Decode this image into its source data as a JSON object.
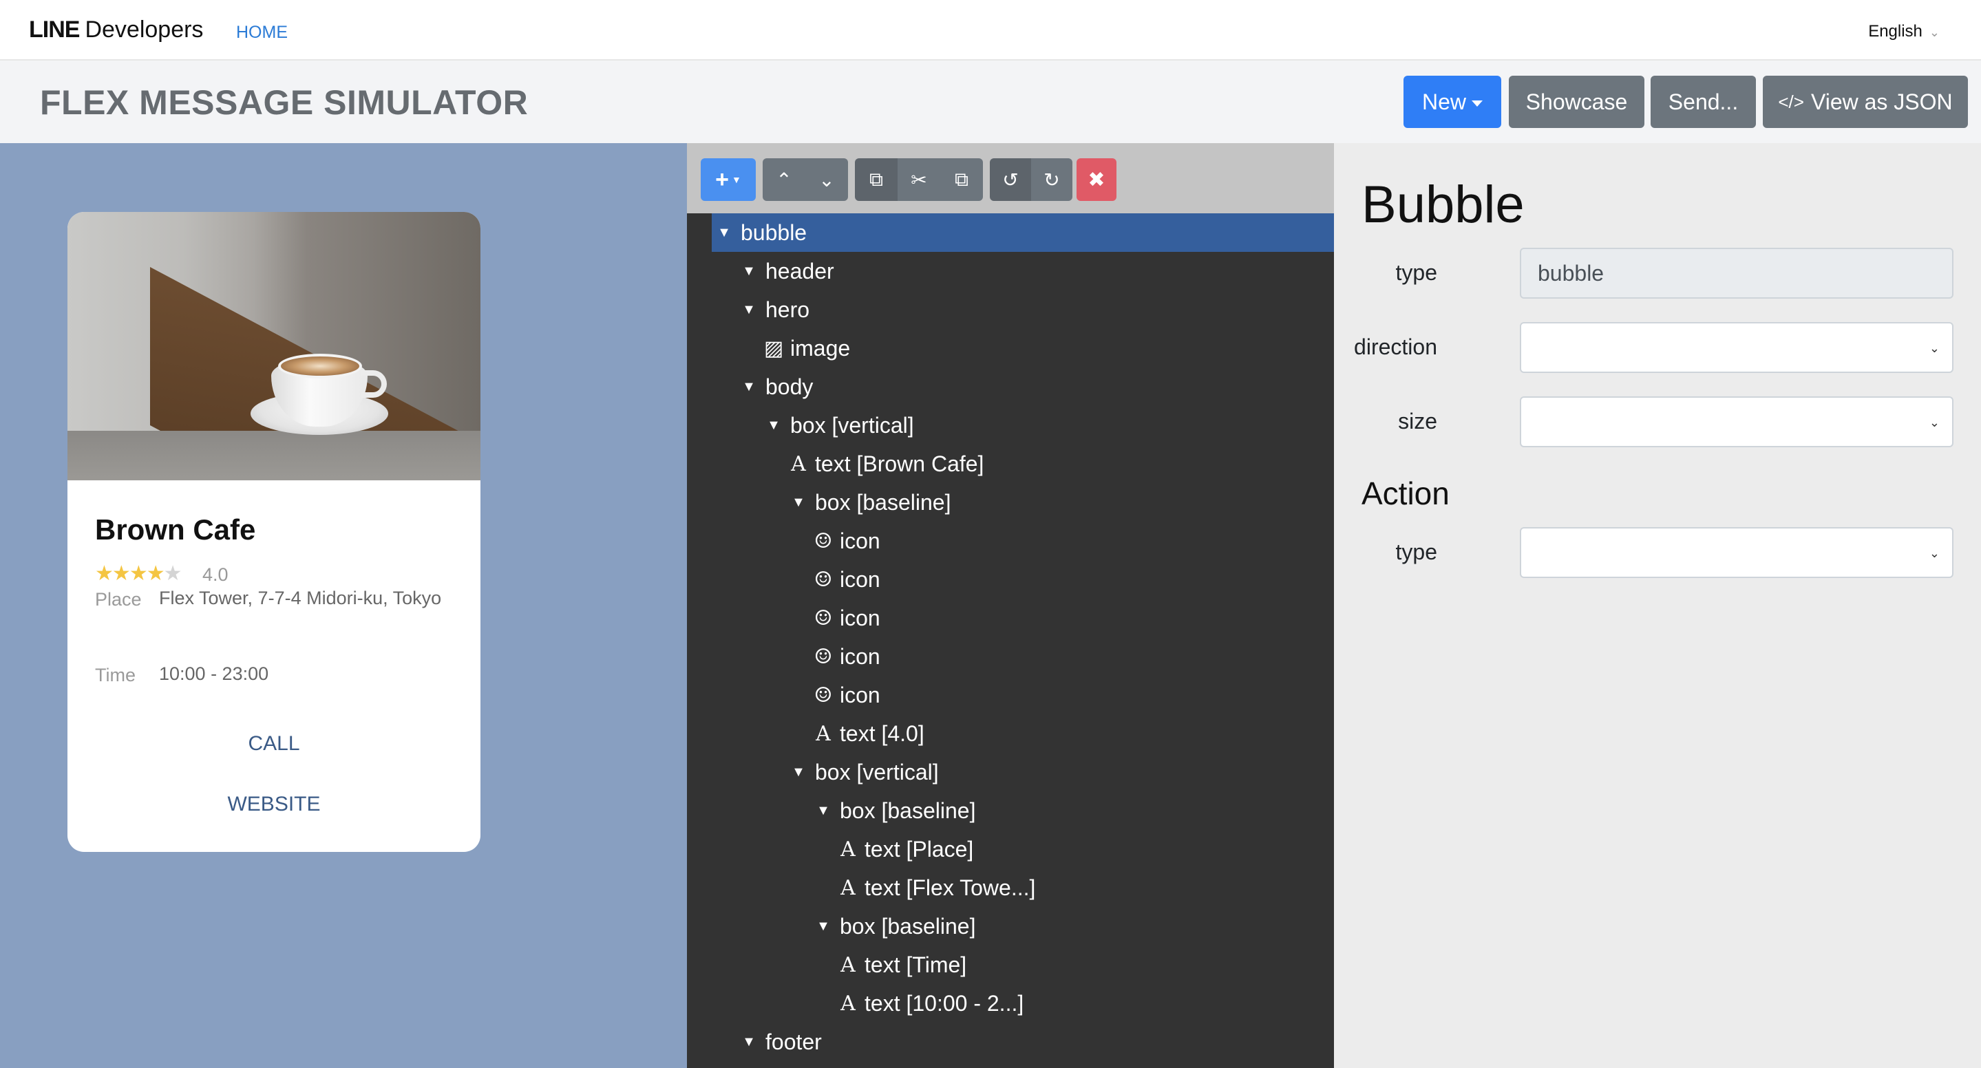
{
  "topnav": {
    "logo_bold": "LINE",
    "logo_text": "Developers",
    "home": "HOME",
    "language": "English"
  },
  "header": {
    "title": "FLEX MESSAGE SIMULATOR",
    "buttons": {
      "new": "New",
      "showcase": "Showcase",
      "send": "Send...",
      "view_json": "View as JSON",
      "view_json_icon": "code-icon"
    }
  },
  "preview": {
    "card": {
      "title": "Brown Cafe",
      "rating": {
        "stars_filled": 4,
        "stars_total": 5,
        "value": "4.0"
      },
      "place_label": "Place",
      "place_value": "Flex Tower, 7-7-4 Midori-ku, Tokyo",
      "time_label": "Time",
      "time_value": "10:00 - 23:00",
      "call": "CALL",
      "website": "WEBSITE"
    }
  },
  "toolbar": {
    "icons": [
      "add-icon",
      "move-up-icon",
      "move-down-icon",
      "copy-icon",
      "cut-icon",
      "paste-icon",
      "undo-icon",
      "redo-icon",
      "delete-icon"
    ]
  },
  "tree": {
    "nodes": [
      {
        "label": "bubble",
        "kind": "toggle",
        "depth": 0,
        "selected": true
      },
      {
        "label": "header",
        "kind": "toggle",
        "depth": 1
      },
      {
        "label": "hero",
        "kind": "toggle",
        "depth": 1
      },
      {
        "label": "image",
        "kind": "image",
        "depth": 2
      },
      {
        "label": "body",
        "kind": "toggle",
        "depth": 1
      },
      {
        "label": "box [vertical]",
        "kind": "toggle",
        "depth": 2
      },
      {
        "label": "text [Brown Cafe]",
        "kind": "text",
        "depth": 3
      },
      {
        "label": "box [baseline]",
        "kind": "toggle",
        "depth": 3
      },
      {
        "label": "icon",
        "kind": "icon",
        "depth": 4
      },
      {
        "label": "icon",
        "kind": "icon",
        "depth": 4
      },
      {
        "label": "icon",
        "kind": "icon",
        "depth": 4
      },
      {
        "label": "icon",
        "kind": "icon",
        "depth": 4
      },
      {
        "label": "icon",
        "kind": "icon",
        "depth": 4
      },
      {
        "label": "text [4.0]",
        "kind": "text",
        "depth": 4
      },
      {
        "label": "box [vertical]",
        "kind": "toggle",
        "depth": 3
      },
      {
        "label": "box [baseline]",
        "kind": "toggle",
        "depth": 4
      },
      {
        "label": "text [Place]",
        "kind": "text",
        "depth": 5
      },
      {
        "label": "text [Flex Towe...]",
        "kind": "text",
        "depth": 5
      },
      {
        "label": "box [baseline]",
        "kind": "toggle",
        "depth": 4
      },
      {
        "label": "text [Time]",
        "kind": "text",
        "depth": 5
      },
      {
        "label": "text [10:00 - 2...]",
        "kind": "text",
        "depth": 5
      },
      {
        "label": "footer",
        "kind": "toggle",
        "depth": 1
      }
    ]
  },
  "properties": {
    "title": "Bubble",
    "type_label": "type",
    "type_value": "bubble",
    "direction_label": "direction",
    "direction_value": "",
    "size_label": "size",
    "size_value": "",
    "action_title": "Action",
    "action_type_label": "type",
    "action_type_value": ""
  },
  "colors": {
    "primary": "#2f7ef6",
    "secondary": "#6c757d",
    "danger": "#e05a66",
    "tree_bg": "#333333",
    "tree_selected": "#355f9d",
    "preview_bg": "#889fc1",
    "link": "#3a5a86"
  }
}
